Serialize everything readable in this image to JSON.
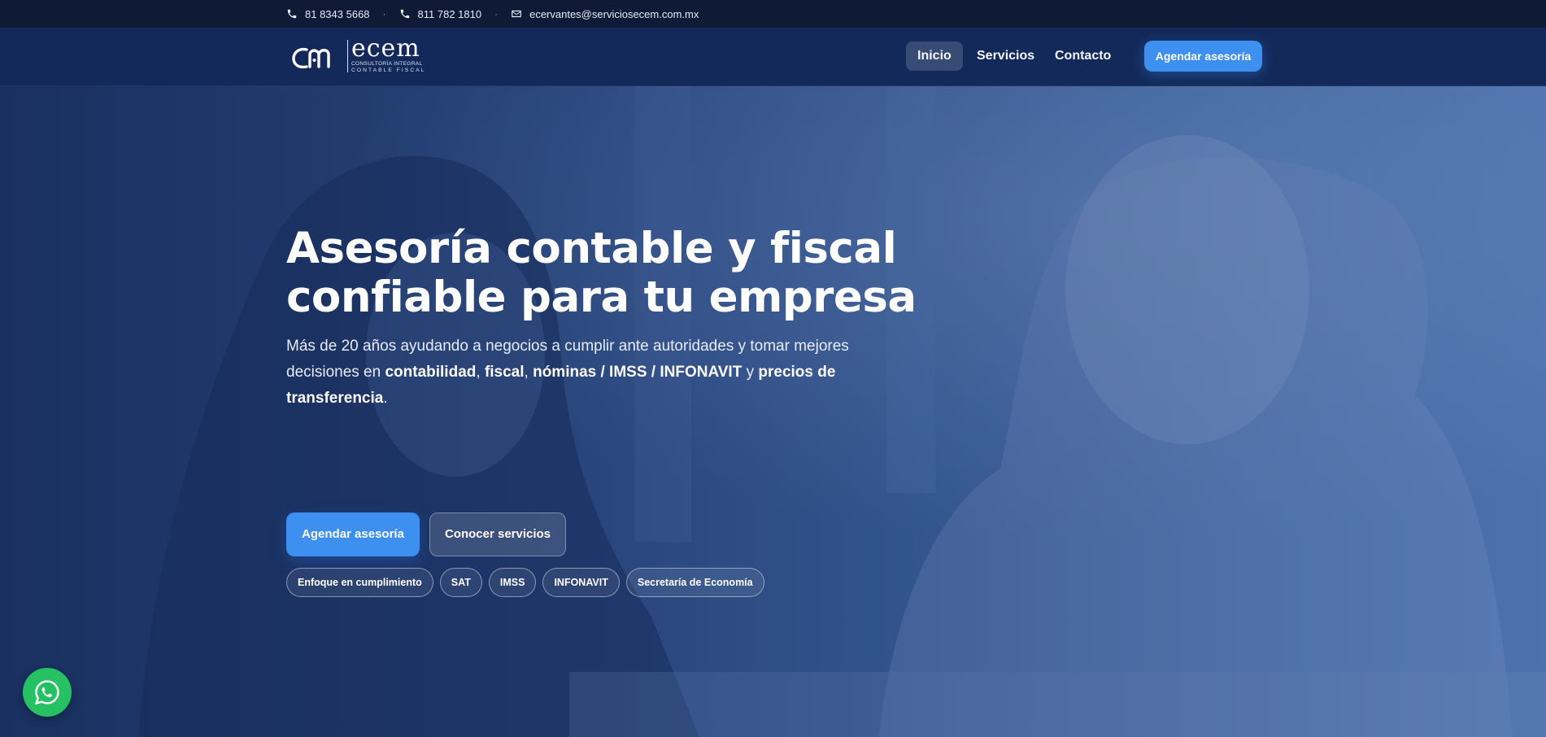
{
  "topbar": {
    "phone1": "81 8343 5668",
    "separator1": "·",
    "phone2": "811 782 1810",
    "separator2": "·",
    "email": "ecervantes@serviciosecem.com.mx"
  },
  "brand": {
    "name": "ecem",
    "tagline1": "CONSULTORÍA INTEGRAL",
    "tagline2": "CONTABLE FISCAL"
  },
  "nav": {
    "items": [
      {
        "label": "Inicio",
        "active": true
      },
      {
        "label": "Servicios",
        "active": false
      },
      {
        "label": "Contacto",
        "active": false
      }
    ],
    "cta_label": "Agendar asesoría"
  },
  "hero": {
    "title_line1": "Asesoría contable y fiscal",
    "title_line2": "confiable para tu empresa",
    "desc": {
      "part1": "Más de 20 años ayudando a negocios a cumplir ante autoridades y tomar mejores decisiones en ",
      "bold1": "contabilidad",
      "sep1": ", ",
      "bold2": "fiscal",
      "sep2": ", ",
      "bold3": "nóminas / IMSS / INFONAVIT",
      "sep3": " y ",
      "bold4": "precios de transferencia",
      "end": "."
    },
    "primary_button": "Agendar asesoría",
    "secondary_button": "Conocer servicios",
    "chips": [
      "Enfoque en cumplimiento",
      "SAT",
      "IMSS",
      "INFONAVIT",
      "Secretaría de Economía"
    ]
  },
  "colors": {
    "topbar_bg": "#0e1a36",
    "header_bg": "#13295a",
    "accent": "#3d8ff0",
    "whatsapp": "#25c163"
  },
  "icons": {
    "phone": "phone-icon",
    "email": "mail-icon",
    "whatsapp": "whatsapp-icon"
  }
}
